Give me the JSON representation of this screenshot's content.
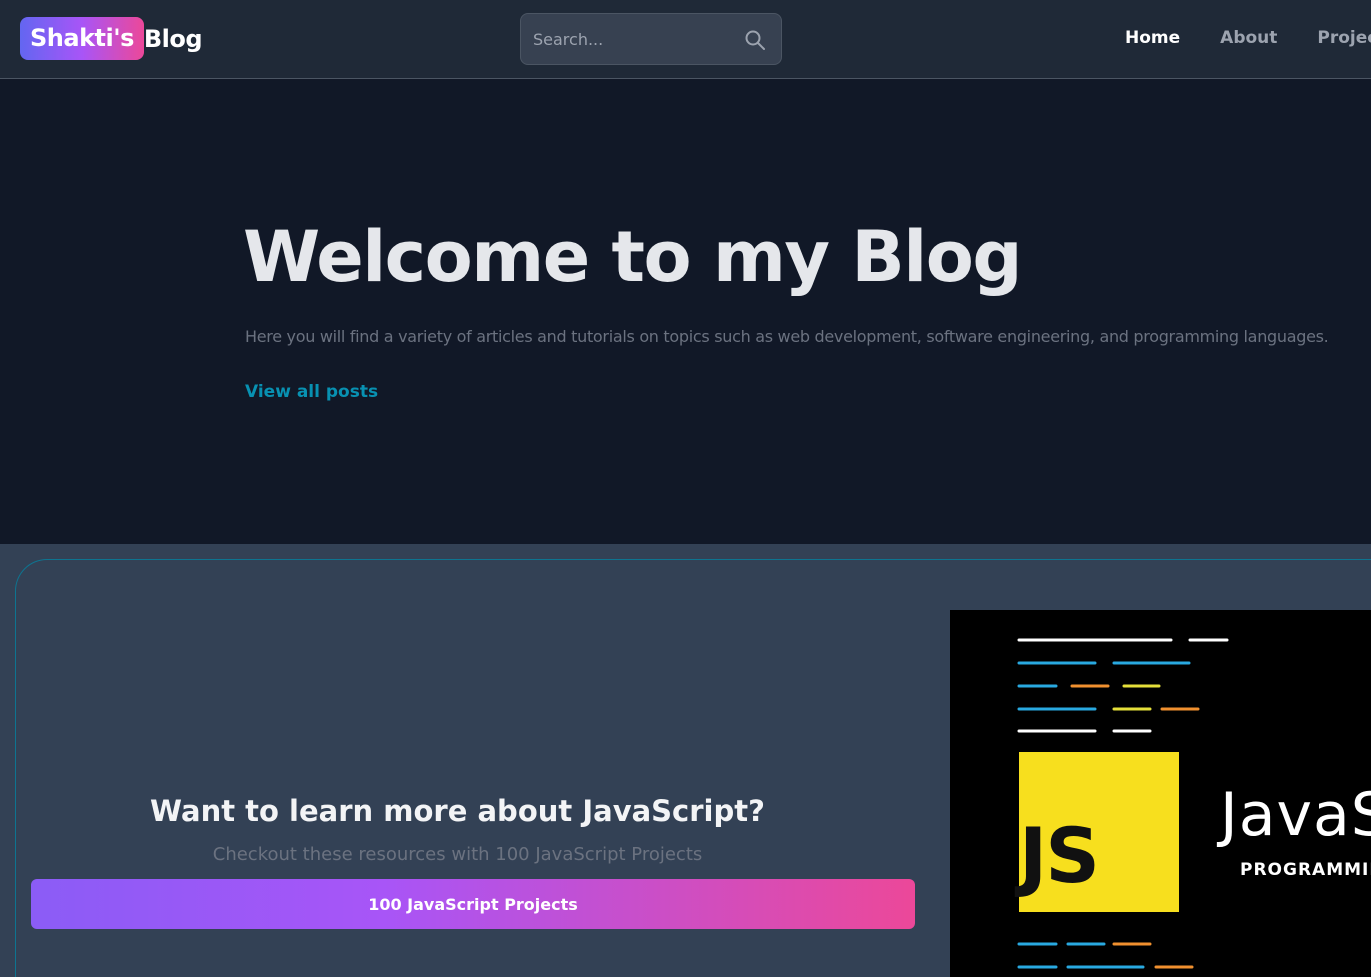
{
  "navbar": {
    "logo_highlight": "Shakti's",
    "logo_rest": "Blog",
    "search_placeholder": "Search...",
    "search_icon": "search-icon",
    "links": [
      "Home",
      "About",
      "Projects"
    ],
    "active_link": "Home"
  },
  "hero": {
    "title": "Welcome to my Blog",
    "text": "Here you will find a variety of articles and tutorials on topics such as web development, software engineering, and programming languages.",
    "link_label": "View all posts"
  },
  "promo": {
    "title": "Want to learn more about JavaScript?",
    "subtitle": "Checkout these resources with 100 JavaScript Projects",
    "button_label": "100 JavaScript Projects",
    "image": {
      "logo_text": "JS",
      "word": "JavaS",
      "caption": "PROGRAMMIN"
    }
  },
  "colors": {
    "background": "#111827",
    "navbar": "#1f2937",
    "promo_background": "#334155",
    "accent_link": "#0891b2",
    "gradient_start": "#8b5cf6",
    "gradient_end": "#ec4899",
    "js_yellow": "#f7df1e"
  }
}
